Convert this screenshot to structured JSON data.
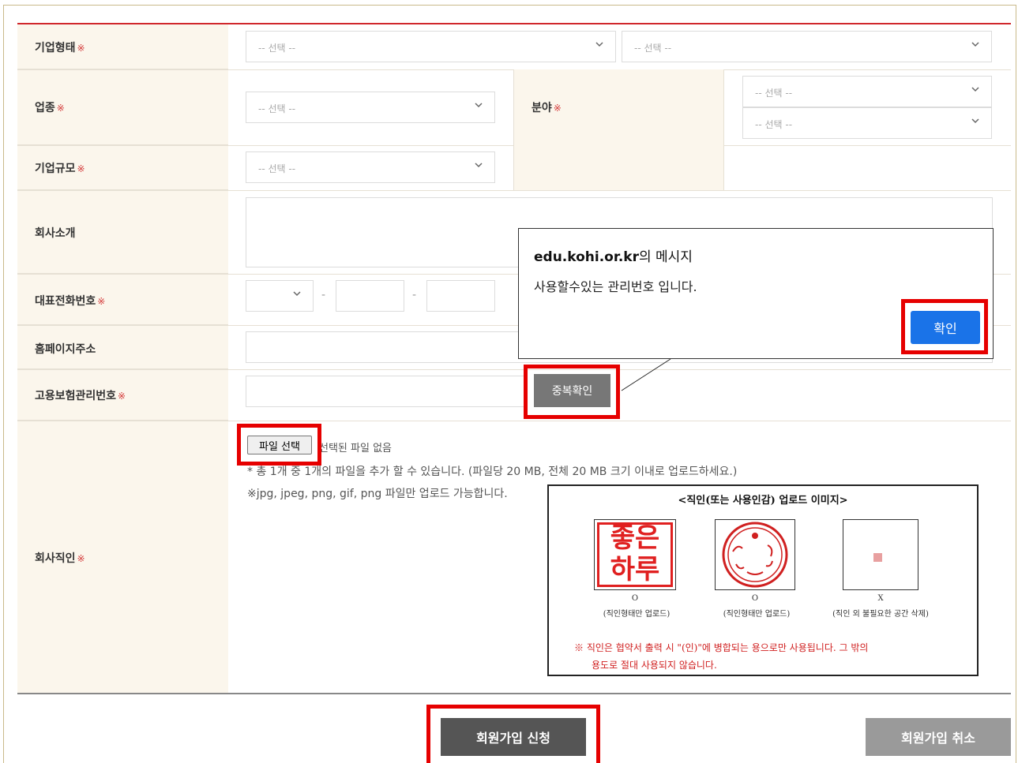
{
  "form": {
    "placeholder": "-- 선택 --",
    "required_mark": "※",
    "labels": {
      "company_type": "기업형태",
      "industry": "업종",
      "field": "분야",
      "company_size": "기업규모",
      "company_intro": "회사소개",
      "phone": "대표전화번호",
      "homepage": "홈페이지주소",
      "insurance_number": "고용보험관리번호",
      "company_seal": "회사직인"
    },
    "phone_separator": "-",
    "duplicate_check_label": "중복확인",
    "file_select_label": "파일 선택",
    "file_status": "선택된 파일 없음",
    "file_note_count": "* 총 1개 중 1개의 파일을 추가 할 수 있습니다. (파일당 20 MB, 전체 20 MB 크기 이내로 업로드하세요.)",
    "file_note_types": "※jpg, jpeg, png, gif, png 파일만 업로드 가능합니다."
  },
  "seal_guide": {
    "title": "<직인(또는 사용인감) 업로드 이미지>",
    "samples": [
      {
        "mark": "O",
        "desc": "(직인형태만 업로드)",
        "text_top": "좋은",
        "text_bottom": "하루"
      },
      {
        "mark": "O",
        "desc": "(직인형태만 업로드)"
      },
      {
        "mark": "X",
        "desc": "(직인 외 불필요한 공간 삭제)"
      }
    ],
    "note_line1": "※ 직인은 협약서 출력 시 \"(인)\"에 병합되는 용으로만 사용됩니다. 그 밖의",
    "note_line2": "용도로 절대 사용되지 않습니다."
  },
  "dialog": {
    "site": "edu.kohi.or.kr",
    "title_suffix": "의 메시지",
    "message": "사용할수있는 관리번호 입니다.",
    "ok_label": "확인",
    "ok_color": "#1a73e8"
  },
  "actions": {
    "submit_label": "회원가입 신청",
    "cancel_label": "회원가입 취소"
  },
  "colors": {
    "accent_red": "#d0272c",
    "highlight": "#e60000",
    "label_bg": "#fbf6ec"
  }
}
